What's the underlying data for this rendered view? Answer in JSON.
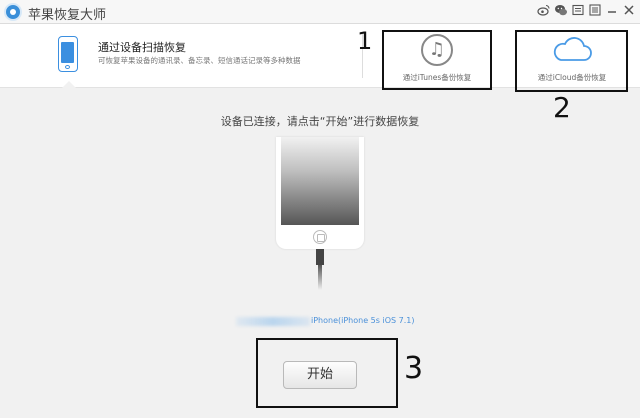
{
  "window": {
    "title": "苹果恢复大师",
    "controls": [
      "weibo-icon",
      "wechat-icon",
      "feedback-icon",
      "menu-icon",
      "minimize-icon",
      "close-icon"
    ]
  },
  "modes": {
    "device_scan": {
      "title": "通过设备扫描恢复",
      "description": "可恢复苹果设备的通讯录、备忘录、短信通话记录等多种数据"
    },
    "itunes": {
      "label": "通过iTunes备份恢复"
    },
    "icloud": {
      "label": "通过iCloud备份恢复"
    }
  },
  "main": {
    "instruction": "设备已连接，请点击“开始”进行数据恢复",
    "device_info": "iPhone(iPhone 5s iOS 7.1)",
    "start_label": "开始"
  },
  "annotations": [
    "1",
    "2",
    "3"
  ],
  "colors": {
    "accent": "#3b8fe0",
    "link": "#4a90d9",
    "annotation": "#111111"
  }
}
